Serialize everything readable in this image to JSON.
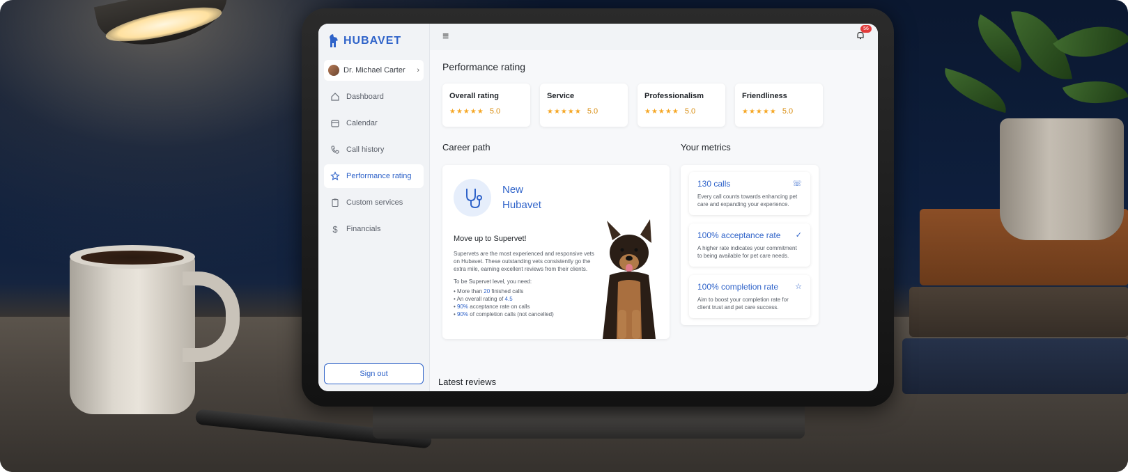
{
  "app": {
    "brand": "HUBAVET"
  },
  "sidebar": {
    "profile_name": "Dr. Michael Carter",
    "items": [
      {
        "label": "Dashboard",
        "icon": "home-icon",
        "active": false
      },
      {
        "label": "Calendar",
        "icon": "calendar-icon",
        "active": false
      },
      {
        "label": "Call history",
        "icon": "phone-icon",
        "active": false
      },
      {
        "label": "Performance rating",
        "icon": "star-icon",
        "active": true
      },
      {
        "label": "Custom services",
        "icon": "clipboard-icon",
        "active": false
      },
      {
        "label": "Financials",
        "icon": "dollar-icon",
        "active": false
      }
    ],
    "signout_label": "Sign out"
  },
  "topbar": {
    "notifications_count": "56"
  },
  "performance": {
    "title": "Performance rating",
    "cards": [
      {
        "title": "Overall rating",
        "stars": "★★★★★",
        "value": "5.0"
      },
      {
        "title": "Service",
        "stars": "★★★★★",
        "value": "5.0"
      },
      {
        "title": "Professionalism",
        "stars": "★★★★★",
        "value": "5.0"
      },
      {
        "title": "Friendliness",
        "stars": "★★★★★",
        "value": "5.0"
      }
    ]
  },
  "career": {
    "title": "Career path",
    "level_line1": "New",
    "level_line2": "Hubavet",
    "move_title": "Move up to Supervet!",
    "description": "Supervets are the most experienced and responsive vets on Hubavet. These outstanding vets consistently go the extra mile, earning excellent reviews from their clients.",
    "requirements_intro": "To be Supervet level, you need:",
    "req1_pre": "More than ",
    "req1_val": "20",
    "req1_post": " finished calls",
    "req2_pre": "An overall rating of ",
    "req2_val": "4.5",
    "req3_val": "90%",
    "req3_post": " acceptance rate on calls",
    "req4_val": "90%",
    "req4_post": " of completion calls (not cancelled)"
  },
  "metrics": {
    "title": "Your metrics",
    "items": [
      {
        "title": "130 calls",
        "desc": "Every call counts towards enhancing pet care and expanding your experience.",
        "icon": "phone-icon"
      },
      {
        "title": "100% acceptance rate",
        "desc": "A higher rate indicates your commitment to being available for pet care needs.",
        "icon": "check-badge-icon"
      },
      {
        "title": "100% completion rate",
        "desc": "Aim to boost your completion rate for client trust and pet care success.",
        "icon": "star-icon"
      }
    ]
  },
  "latest_reviews": {
    "title": "Latest reviews"
  },
  "colors": {
    "accent": "#2f63c9",
    "star": "#f5a623",
    "badge": "#e23b3b"
  }
}
